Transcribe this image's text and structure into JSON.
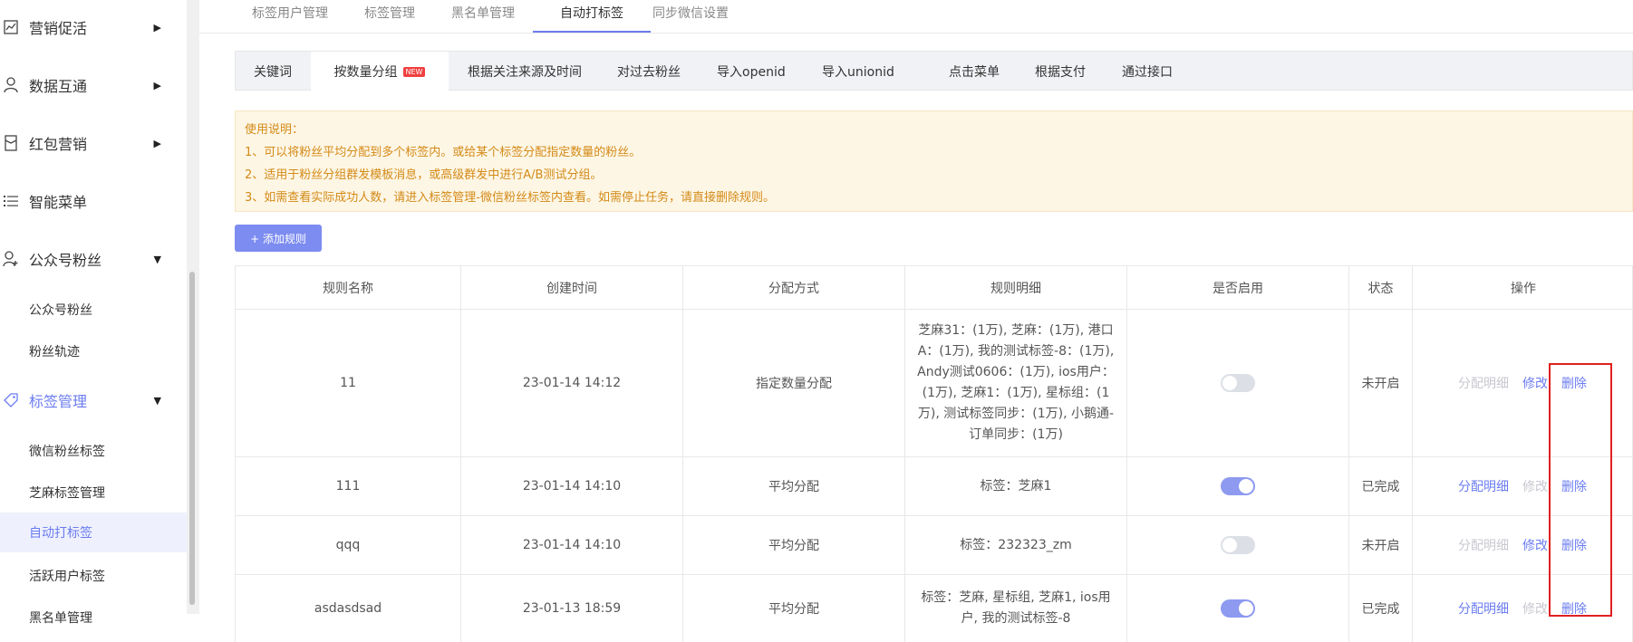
{
  "sidebar": {
    "groups": [
      {
        "label": "营销促活",
        "icon": "chart-line-icon",
        "arrow": "▶"
      },
      {
        "label": "数据互通",
        "icon": "user-icon",
        "arrow": "▶"
      },
      {
        "label": "红包营销",
        "icon": "red-packet-icon",
        "arrow": "▶"
      },
      {
        "label": "智能菜单",
        "icon": "list-icon",
        "arrow": ""
      },
      {
        "label": "公众号粉丝",
        "icon": "user-add-icon",
        "arrow": "▼"
      },
      {
        "label": "标签管理",
        "icon": "tag-icon",
        "arrow": "▼"
      }
    ],
    "fans_sub": [
      "公众号粉丝",
      "粉丝轨迹"
    ],
    "tag_sub": [
      "微信粉丝标签",
      "芝麻标签管理",
      "自动打标签",
      "活跃用户标签",
      "黑名单管理"
    ],
    "active_sub": "自动打标签"
  },
  "top_tabs": [
    "标签用户管理",
    "标签管理",
    "黑名单管理",
    "自动打标签",
    "同步微信设置"
  ],
  "active_top_tab": "自动打标签",
  "sub_tabs": [
    "关键词",
    "按数量分组",
    "根据关注来源及时间",
    "对过去粉丝",
    "导入openid",
    "导入unionid",
    "点击菜单",
    "根据支付",
    "通过接口"
  ],
  "new_badge": "NEW",
  "notice": {
    "title": "使用说明：",
    "lines": [
      "1、可以将粉丝平均分配到多个标签内。或给某个标签分配指定数量的粉丝。",
      "2、适用于粉丝分组群发模板消息，或高级群发中进行A/B测试分组。",
      "3、如需查看实际成功人数，请进入标签管理-微信粉丝标签内查看。如需停止任务，请直接删除规则。"
    ]
  },
  "add_button": "+ 添加规则",
  "table": {
    "headers": [
      "规则名称",
      "创建时间",
      "分配方式",
      "规则明细",
      "是否启用",
      "状态",
      "操作"
    ],
    "rows": [
      {
        "name": "11",
        "time": "23-01-14 14:12",
        "mode": "指定数量分配",
        "detail": "芝麻31：(1万), 芝麻：(1万), 港口A：(1万), 我的测试标签-8：(1万), Andy测试0606：(1万), ios用户：(1万), 芝麻1：(1万), 星标组：(1万), 测试标签同步：(1万), 小鹅通-订单同步：(1万)",
        "enabled": false,
        "status": "未开启",
        "detail_op_enabled": false,
        "edit_op_enabled": true
      },
      {
        "name": "111",
        "time": "23-01-14 14:10",
        "mode": "平均分配",
        "detail": "标签：芝麻1",
        "enabled": true,
        "status": "已完成",
        "detail_op_enabled": true,
        "edit_op_enabled": false
      },
      {
        "name": "qqq",
        "time": "23-01-14 14:10",
        "mode": "平均分配",
        "detail": "标签：232323_zm",
        "enabled": false,
        "status": "未开启",
        "detail_op_enabled": false,
        "edit_op_enabled": true
      },
      {
        "name": "asdasdsad",
        "time": "23-01-13 18:59",
        "mode": "平均分配",
        "detail": "标签：芝麻, 星标组, 芝麻1, ios用户, 我的测试标签-8",
        "enabled": true,
        "status": "已完成",
        "detail_op_enabled": true,
        "edit_op_enabled": false
      }
    ],
    "ops": {
      "detail": "分配明细",
      "edit": "修改",
      "delete": "删除"
    }
  },
  "colors": {
    "accent": "#6b7cf0",
    "notice_text": "#d48a17",
    "highlight": "#e02020"
  }
}
